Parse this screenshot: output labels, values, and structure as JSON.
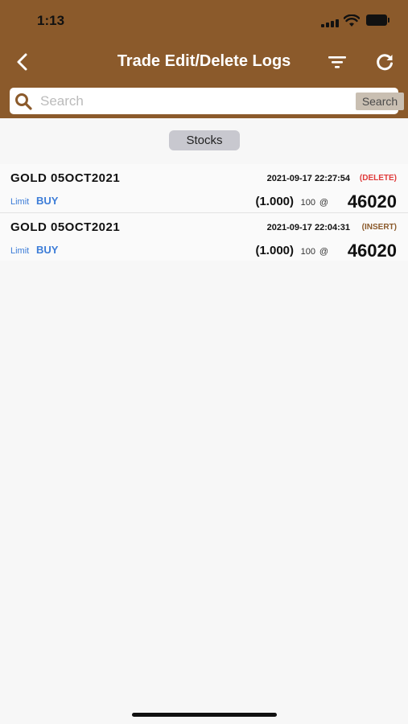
{
  "status_bar": {
    "time": "1:13"
  },
  "nav": {
    "title": "Trade Edit/Delete Logs"
  },
  "search": {
    "placeholder": "Search",
    "value": "",
    "button_label": "Search"
  },
  "segment": {
    "label": "Stocks"
  },
  "colors": {
    "header_bg": "#8b5a2b",
    "accent_blue": "#3d7dd8",
    "delete_red": "#e03a3a",
    "insert_brown": "#8b5a2b"
  },
  "logs": [
    {
      "symbol": "GOLD 05OCT2021",
      "timestamp": "2021-09-17 22:27:54",
      "action": "(DELETE)",
      "action_color": "#e03a3a",
      "order_type": "Limit",
      "side": "BUY",
      "qty": "(1.000)",
      "lot": "100",
      "at": "@",
      "price": "46020"
    },
    {
      "symbol": "GOLD 05OCT2021",
      "timestamp": "2021-09-17 22:04:31",
      "action": "(INSERT)",
      "action_color": "#8b5a2b",
      "order_type": "Limit",
      "side": "BUY",
      "qty": "(1.000)",
      "lot": "100",
      "at": "@",
      "price": "46020"
    }
  ]
}
